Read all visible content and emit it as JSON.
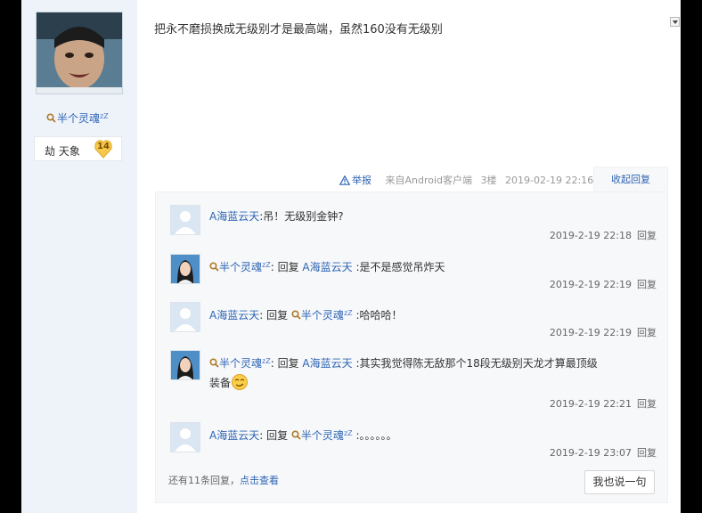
{
  "author": {
    "name": "半个灵魂",
    "zz": "zZ",
    "level_name": "劫 天象",
    "level_number": "14"
  },
  "post": {
    "content": "把永不磨损换成无级别才是最高端，虽然160没有无级别",
    "report": "举报",
    "source": "来自Android客户端",
    "floor": "3楼",
    "time": "2019-02-19 22:16",
    "collapse": "收起回复"
  },
  "replies": [
    {
      "user": "A海蓝云天",
      "reply_word": "",
      "target": "",
      "text": ":吊！无级别金钟?",
      "time": "2019-2-19 22:18",
      "action": "回复"
    },
    {
      "user": "半个灵魂",
      "reply_word": "回复",
      "target": "A海蓝云天",
      "text": ":是不是感觉吊炸天",
      "time": "2019-2-19 22:19",
      "action": "回复"
    },
    {
      "user": "A海蓝云天",
      "reply_word": "回复",
      "target": "半个灵魂",
      "text": ":哈哈哈！",
      "time": "2019-2-19 22:19",
      "action": "回复"
    },
    {
      "user": "半个灵魂",
      "reply_word": "回复",
      "target": "A海蓝云天",
      "text": ":其实我觉得陈无敌那个18段无级别天龙才算最顶级",
      "text2": "装备",
      "time": "2019-2-19 22:21",
      "action": "回复"
    },
    {
      "user": "A海蓝云天",
      "reply_word": "回复",
      "target": "半个灵魂",
      "text": ":。。。。。。",
      "time": "2019-2-19 23:07",
      "action": "回复"
    }
  ],
  "more": {
    "prefix": "还有11条回复，",
    "link": "点击查看"
  },
  "say_button": "我也说一句",
  "colors": {
    "link": "#2d64b3",
    "sidebar_bg": "#eef3fa",
    "lzl_bg": "#f7f8fa"
  }
}
